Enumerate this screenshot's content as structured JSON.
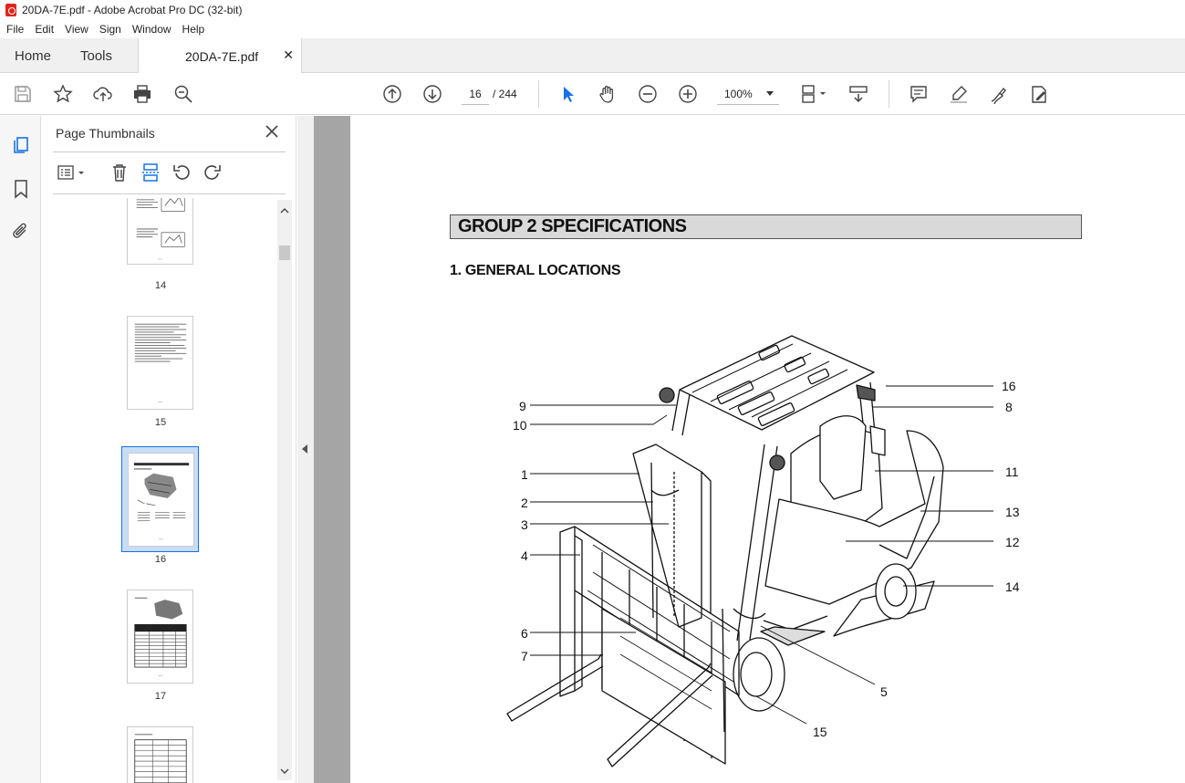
{
  "window": {
    "title": "20DA-7E.pdf - Adobe Acrobat Pro DC (32-bit)"
  },
  "menu": [
    "File",
    "Edit",
    "View",
    "Sign",
    "Window",
    "Help"
  ],
  "tabs": {
    "home": "Home",
    "tools": "Tools",
    "doc": "20DA-7E.pdf"
  },
  "toolbar": {
    "page_current": "16",
    "page_total": "/ 244",
    "zoom": "100%"
  },
  "panel": {
    "title": "Page Thumbnails",
    "thumbnails": [
      {
        "label": "14"
      },
      {
        "label": "15"
      },
      {
        "label": "16",
        "selected": true
      },
      {
        "label": "17"
      },
      {
        "label": ""
      }
    ]
  },
  "document": {
    "heading": "GROUP 2  SPECIFICATIONS",
    "subheading": "1. GENERAL LOCATIONS",
    "callouts": [
      "1",
      "2",
      "3",
      "4",
      "5",
      "6",
      "7",
      "8",
      "9",
      "10",
      "11",
      "12",
      "13",
      "14",
      "15",
      "16"
    ]
  },
  "colors": {
    "accent": "#1473e6",
    "selection": "#1473e6",
    "canvas": "#a5a5a5"
  }
}
